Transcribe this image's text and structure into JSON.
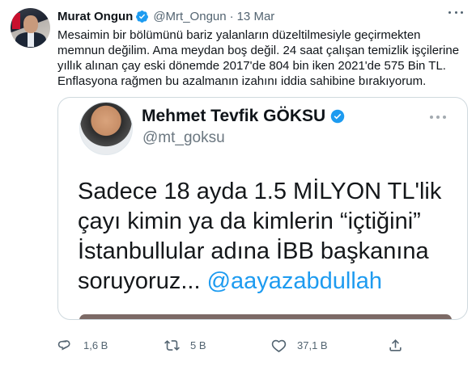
{
  "tweet": {
    "author_name": "Murat Ongun",
    "author_handle": "@Mrt_Ongun",
    "separator": "·",
    "date": "13 Mar",
    "text_lines": [
      "Mesaimin bir bölümünü bariz yalanların düzeltilmesiyle geçirmekten",
      "memnun değilim. Ama meydan boş değil. 24 saat çalışan temizlik işçilerine",
      "yıllık alınan çay eski dönemde 2017'de 804 bin iken 2021'de 575 Bin TL.",
      "Enflasyona rağmen bu azalmanın izahını iddia sahibine bırakıyorum."
    ]
  },
  "media": {
    "author_name": "Mehmet Tevfik GÖKSU",
    "author_handle": "@mt_goksu",
    "body_lines": [
      "Sadece 18 ayda 1.5 MİLYON TL'lik",
      "çayı kimin ya da kimlerin “içtiğini”",
      "İstanbullular adına İBB başkanına"
    ],
    "last_line_text": "soruyoruz...",
    "mention": "@aayazabdullah"
  },
  "actions": {
    "replies": "1,6 B",
    "retweets": "5 B",
    "likes": "37,1 B"
  },
  "colors": {
    "accent": "#1d9bf0",
    "secondary_text": "#536471",
    "border": "#cfd9de"
  },
  "icons": [
    "verified-badge-icon",
    "more-icon",
    "reply-icon",
    "retweet-icon",
    "like-icon",
    "share-icon"
  ]
}
